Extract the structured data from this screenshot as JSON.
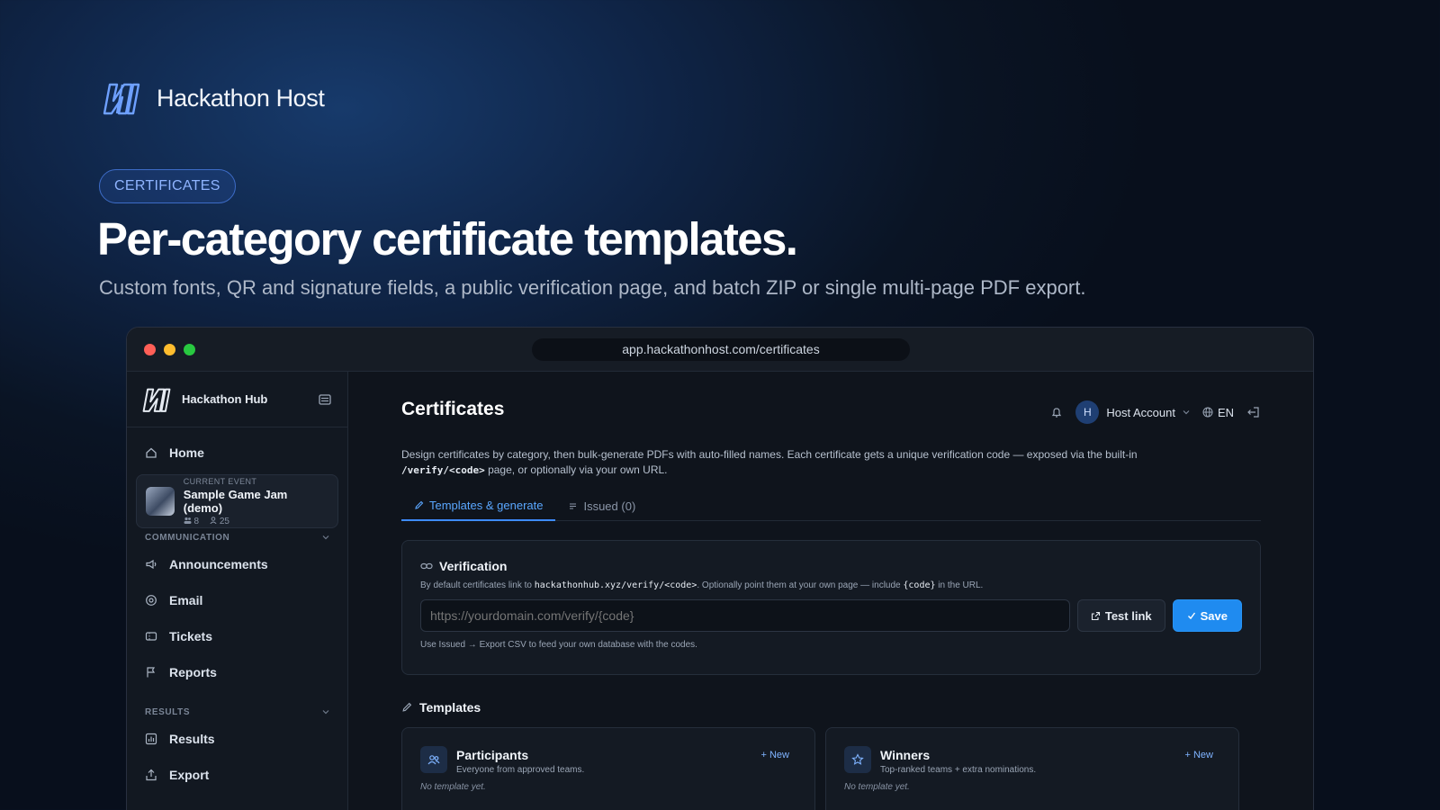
{
  "hero": {
    "brand": "Hackathon Host",
    "badge": "CERTIFICATES",
    "headline": "Per-category certificate templates.",
    "subtitle": "Custom fonts, QR and signature fields, a public verification page, and batch ZIP or single multi-page PDF export."
  },
  "browser": {
    "url": "app.hackathonhost.com/certificates"
  },
  "sidebar": {
    "brand": "Hackathon Hub",
    "home": "Home",
    "event": {
      "label": "CURRENT EVENT",
      "name": "Sample Game Jam (demo)",
      "teams": "8",
      "members": "25"
    },
    "sections": [
      {
        "label": "COMMUNICATION",
        "items": [
          "Announcements",
          "Email",
          "Tickets",
          "Reports"
        ]
      },
      {
        "label": "RESULTS",
        "items": [
          "Results",
          "Export"
        ]
      }
    ]
  },
  "header": {
    "title": "Certificates",
    "account": "Host Account",
    "avatar_initial": "H",
    "language": "EN"
  },
  "description": {
    "part1": "Design certificates by category, then bulk-generate PDFs with auto-filled names. Each certificate gets a unique verification code — exposed via the built-in",
    "code": "/verify/<code>",
    "part2": "page, or optionally via your own URL."
  },
  "tabs": [
    "Templates & generate",
    "Issued (0)"
  ],
  "verification": {
    "title": "Verification",
    "help_prefix": "By default certificates link to",
    "help_code": "hackathonhub.xyz/verify/<code>",
    "help_mid": ". Optionally point them at your own page — include",
    "help_token": "{code}",
    "help_suffix": "in the URL.",
    "placeholder": "https://yourdomain.com/verify/{code}",
    "test_button": "Test link",
    "save_button": "Save",
    "note": "Use Issued → Export CSV to feed your own database with the codes."
  },
  "templates": {
    "heading": "Templates",
    "cards": [
      {
        "title": "Participants",
        "subtitle": "Everyone from approved teams.",
        "new": "New",
        "empty": "No template yet."
      },
      {
        "title": "Winners",
        "subtitle": "Top-ranked teams + extra nominations.",
        "new": "New",
        "empty": "No template yet."
      }
    ]
  },
  "colors": {
    "accent": "#1f8bf0",
    "tab_active": "#5aa7ff",
    "badge": "#8fb4ff"
  }
}
